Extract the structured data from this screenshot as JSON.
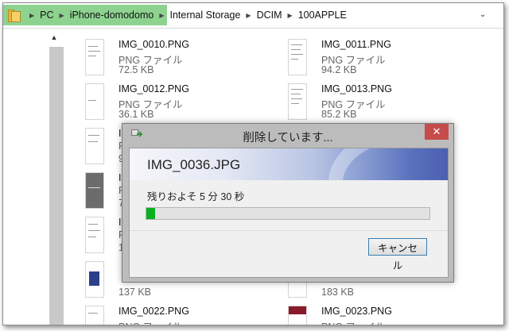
{
  "breadcrumb": {
    "items": [
      "PC",
      "iPhone-domodomo",
      "Internal Storage",
      "DCIM",
      "100APPLE"
    ],
    "highlight_color": "#8dd38f"
  },
  "files": [
    {
      "name": "IMG_0010.PNG",
      "type": "PNG ファイル",
      "size": "72.5 KB",
      "thumb": "doc"
    },
    {
      "name": "IMG_0011.PNG",
      "type": "PNG ファイル",
      "size": "94.2 KB",
      "thumb": "doc"
    },
    {
      "name": "IMG_0012.PNG",
      "type": "PNG ファイル",
      "size": "36.1 KB",
      "thumb": "doc"
    },
    {
      "name": "IMG_0013.PNG",
      "type": "PNG ファイル",
      "size": "85.2 KB",
      "thumb": "doc"
    },
    {
      "name": "I",
      "type": "P",
      "size": "9",
      "thumb": "doc"
    },
    {
      "name": "I",
      "type": "P",
      "size": "7",
      "thumb": "dark"
    },
    {
      "name": "I",
      "type": "P",
      "size": "1",
      "thumb": "doc"
    },
    {
      "name": "",
      "type": "",
      "size": "137 KB",
      "thumb": "blue"
    },
    {
      "name": "",
      "type": "",
      "size": "183 KB",
      "thumb": "doc"
    },
    {
      "name": "IMG_0022.PNG",
      "type": "PNG ファイル",
      "size": "",
      "thumb": "doc"
    },
    {
      "name": "IMG_0023.PNG",
      "type": "PNG ファイル",
      "size": "",
      "thumb": "red"
    }
  ],
  "dialog": {
    "title": "削除しています...",
    "filename": "IMG_0036.JPG",
    "remaining": "残りおよそ 5 分 30 秒",
    "progress_percent": 3,
    "cancel_label": "キャンセル",
    "close_glyph": "✕",
    "close_color": "#c74b4b",
    "progress_color": "#0bb020"
  }
}
